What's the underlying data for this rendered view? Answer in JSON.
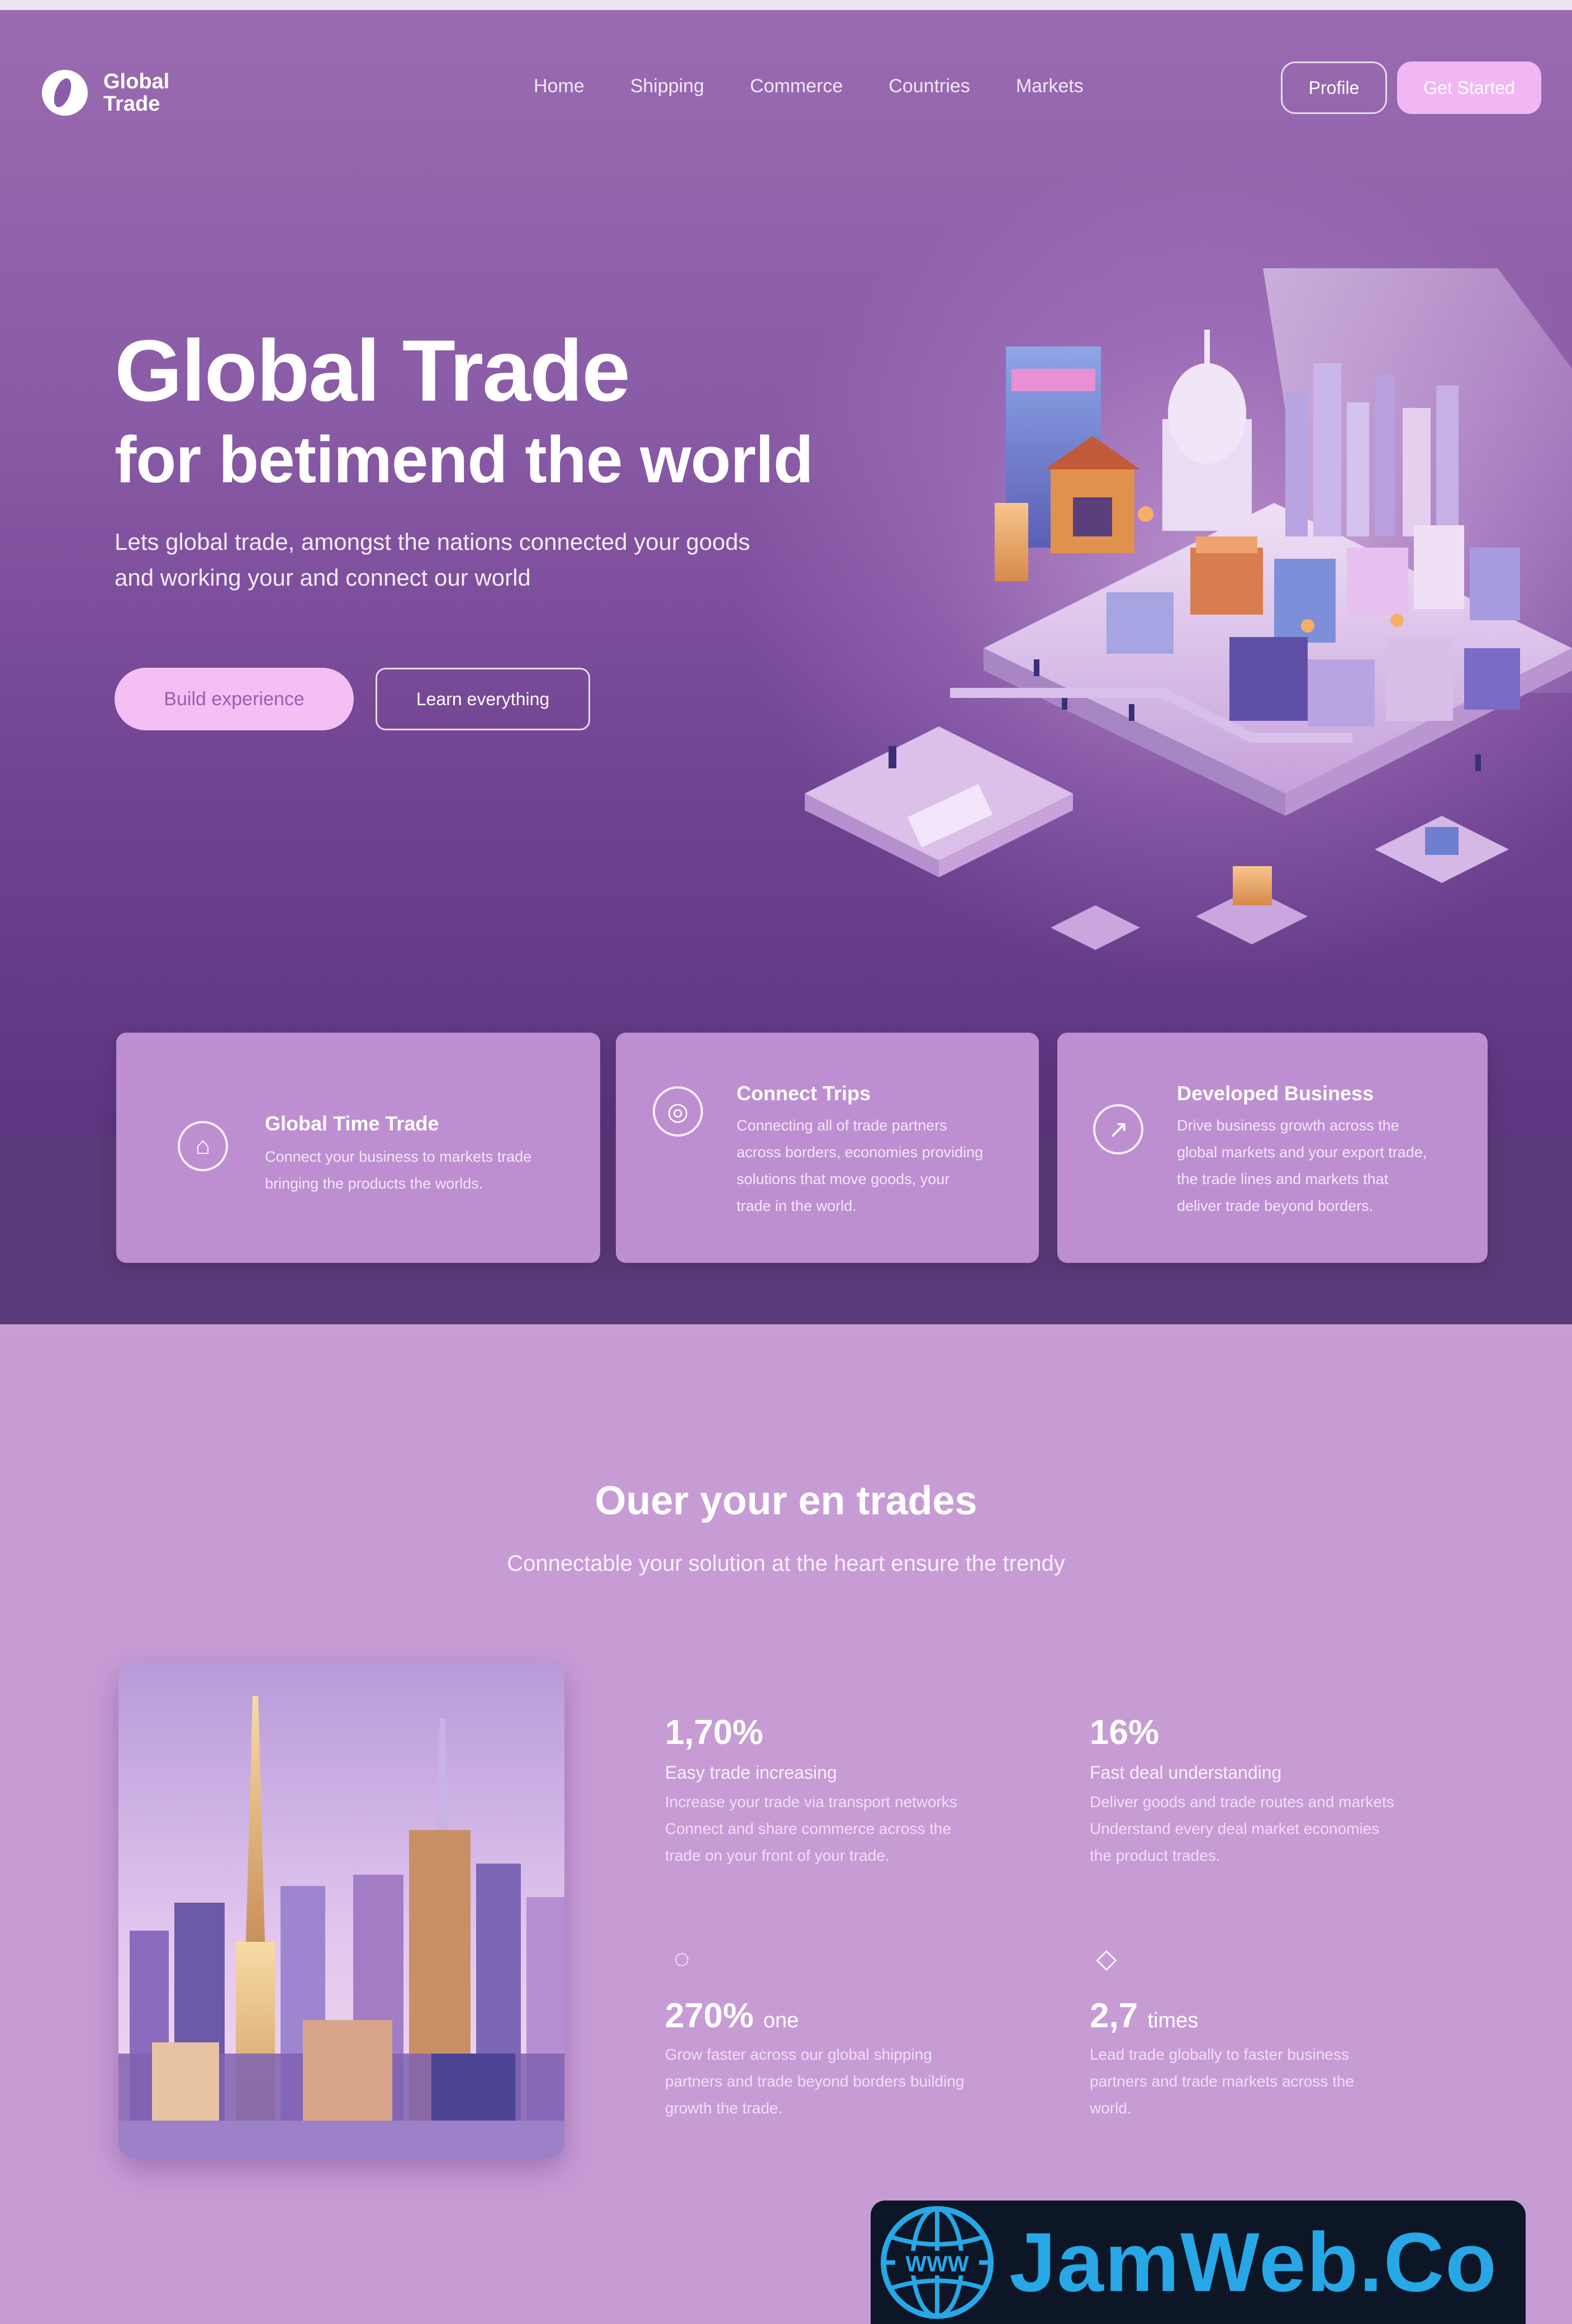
{
  "brand": {
    "line1": "Global",
    "line2": "Trade"
  },
  "nav": {
    "items": [
      "Home",
      "Shipping",
      "Commerce",
      "Countries",
      "Markets"
    ],
    "signin": "Profile",
    "cta": "Get Started"
  },
  "hero": {
    "title": "Global Trade",
    "subtitle": "for betimend the world",
    "description_1": "Lets global trade, amongst the nations connected your goods",
    "description_2": "and working your and connect our world",
    "primary_button": "Build experience",
    "secondary_button": "Learn everything"
  },
  "features": [
    {
      "title": "Global Time Trade",
      "text": [
        "Connect your business to markets trade",
        "bringing the products the worlds."
      ]
    },
    {
      "title": "Connect Trips",
      "text": [
        "Connecting all of trade partners",
        "across borders, economies providing",
        "solutions that move goods, your",
        "trade in the world."
      ]
    },
    {
      "title": "Developed Business",
      "text": [
        "Drive business growth across the",
        "global markets and your export trade,",
        "the trade lines and markets that",
        "deliver trade beyond borders."
      ]
    }
  ],
  "section2": {
    "title": "Ouer your en trades",
    "subtitle": "Connectable your solution at the heart ensure the trendy"
  },
  "stats": [
    {
      "num": "1,70%",
      "unit": "",
      "label": "Easy trade increasing",
      "text": [
        "Increase your trade via transport networks",
        "Connect and share commerce across the",
        "trade on your front of your trade."
      ]
    },
    {
      "num": "16%",
      "unit": "",
      "label": "Fast deal understanding",
      "text": [
        "Deliver goods and trade routes and markets",
        "Understand every deal market economies",
        "the product trades."
      ]
    },
    {
      "num": "270%",
      "unit": "one",
      "label": "",
      "text": [
        "Grow faster across our global shipping",
        "partners and trade beyond borders building",
        "growth the trade."
      ]
    },
    {
      "num": "2,7",
      "unit": "times",
      "label": "",
      "text": [
        "Lead trade globally to faster business",
        "partners and trade markets across the",
        "world."
      ]
    }
  ],
  "watermark": "JamWeb.Co",
  "colors": {
    "hero_top": "#9a6bb1",
    "hero_bottom": "#5b357f",
    "card": "#bd8fd1",
    "accent_pink": "#f1b7f5",
    "section_bg": "#c79cd5",
    "watermark_blue": "#27a7e6"
  }
}
